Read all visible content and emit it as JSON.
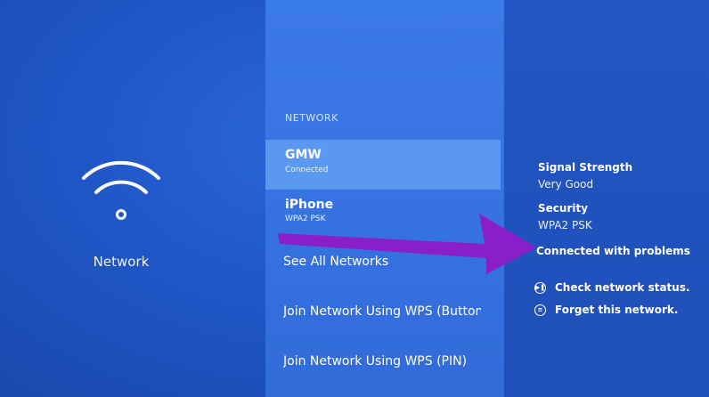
{
  "left_panel": {
    "icon": "wifi-icon",
    "title": "Network"
  },
  "network_list": {
    "header": "NETWORK",
    "networks": [
      {
        "name": "GMW",
        "status": "Connected",
        "selected": true
      },
      {
        "name": "iPhone",
        "status": "WPA2 PSK",
        "selected": false
      }
    ],
    "options": [
      {
        "label": "See All Networks"
      },
      {
        "label": "Join Network Using WPS (Button)"
      },
      {
        "label": "Join Network Using WPS (PIN)"
      }
    ]
  },
  "details": {
    "signal_strength_label": "Signal Strength",
    "signal_strength_value": "Very Good",
    "security_label": "Security",
    "security_value": "WPA2 PSK",
    "connection_status": "Connected with problems",
    "actions": [
      {
        "label": "Check network status.",
        "icon": "play-pause-icon"
      },
      {
        "label": "Forget this network.",
        "icon": "menu-icon"
      }
    ]
  },
  "annotation": {
    "arrow_color": "#8a1fc9"
  },
  "colors": {
    "background": "#1f53c0",
    "list_panel": "#3572e0",
    "selected_row": "#5b98f0"
  }
}
